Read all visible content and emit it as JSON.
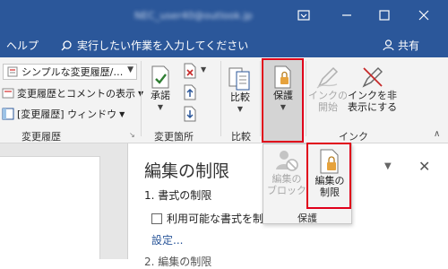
{
  "titlebar": {
    "title": "NEC_user40@outlook.jp"
  },
  "menubar": {
    "help": "ヘルプ",
    "tell_me": "実行したい作業を入力してください",
    "share": "共有"
  },
  "ribbon": {
    "tracking": {
      "markup_dropdown": "シンプルな変更履歴/…",
      "show_markup": "変更履歴とコメントの表示",
      "reviewing_pane": "[変更履歴] ウィンドウ",
      "group_label": "変更履歴"
    },
    "changes": {
      "accept": "承諾",
      "group_label": "変更箇所"
    },
    "compare": {
      "compare": "比較",
      "group_label": "比較"
    },
    "protect": {
      "protect": "保護"
    },
    "ink": {
      "start_inking": "インクの\n開始",
      "hide_ink": "インクを非\n表示にする",
      "group_label": "インク"
    }
  },
  "popup": {
    "block_authors": "編集の\nブロック",
    "restrict_editing": "編集の\n制限",
    "group_label": "保護"
  },
  "pane": {
    "title": "編集の制限",
    "section1": "1. 書式の制限",
    "checkbox_label": "利用可能な書式を制限する",
    "settings_link": "設定...",
    "section2": "2. 編集の制限"
  },
  "colors": {
    "brand": "#2b579a",
    "highlight": "#e0001a",
    "disabled": "#a8a8a8"
  }
}
